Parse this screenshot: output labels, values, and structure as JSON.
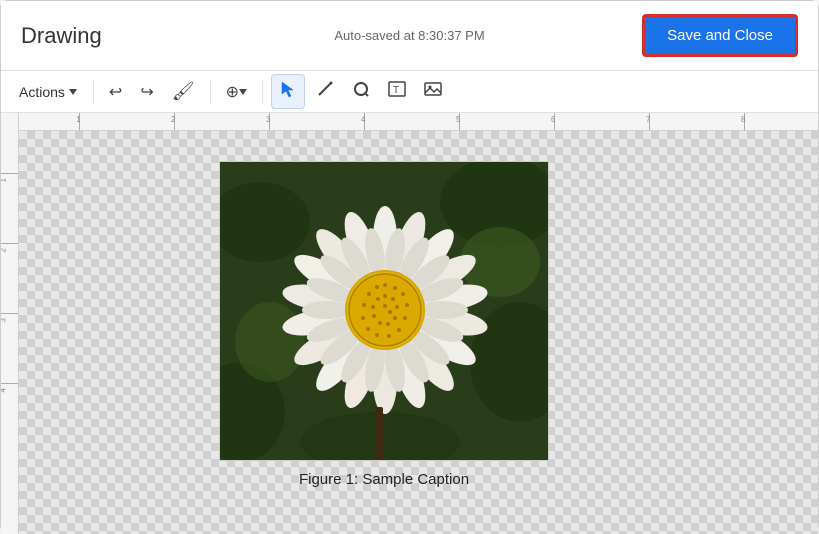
{
  "header": {
    "title": "Drawing",
    "autosave_text": "Auto-saved at 8:30:37 PM",
    "save_close_label": "Save and Close"
  },
  "toolbar": {
    "actions_label": "Actions",
    "undo_icon": "↩",
    "redo_icon": "↪",
    "paint_format_icon": "🖌",
    "zoom_label": "⊕",
    "select_icon": "▲",
    "line_icon": "╱",
    "shape_icon": "◯",
    "text_icon": "T",
    "image_icon": "🖼"
  },
  "canvas": {
    "image_caption": "Figure 1: Sample Caption",
    "ruler_h_marks": [
      "1",
      "2",
      "3",
      "4",
      "5",
      "6",
      "7",
      "8"
    ],
    "ruler_v_marks": [
      "1",
      "2",
      "3",
      "4"
    ]
  }
}
